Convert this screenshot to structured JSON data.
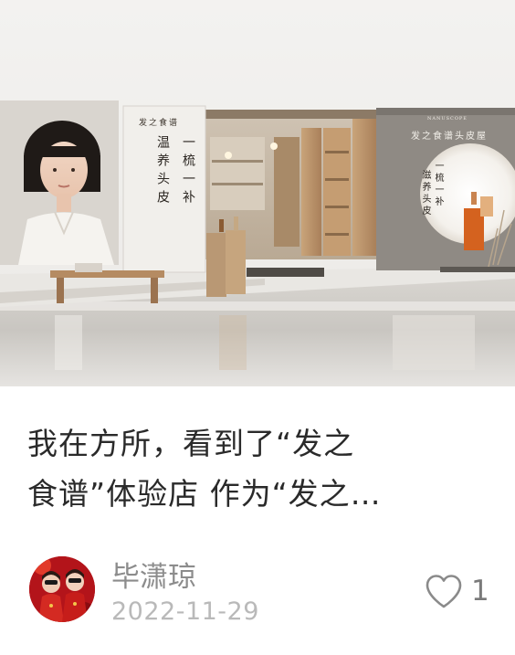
{
  "cover": {
    "brand_logo": "NANUSCOPE",
    "poster_left_small": "发之食谱",
    "poster_left_columns": [
      "温养头皮",
      "一梳一补"
    ],
    "poster_right_small": "发之食谱头皮屋",
    "poster_right_columns": [
      "一梳一补",
      "滋养头皮"
    ]
  },
  "post": {
    "title_lines": [
      "我在方所，看到了“发之",
      "食谱”体验店 作为“发之…"
    ]
  },
  "author": {
    "name": "毕潇琼",
    "date": "2022-11-29"
  },
  "likes": {
    "count": "1"
  },
  "colors": {
    "title": "#2a2a2a",
    "author": "#8c8c8c",
    "date": "#b9b9b9",
    "accent_orange": "#d4621f"
  },
  "icons": {
    "like": "heart-outline-icon"
  }
}
